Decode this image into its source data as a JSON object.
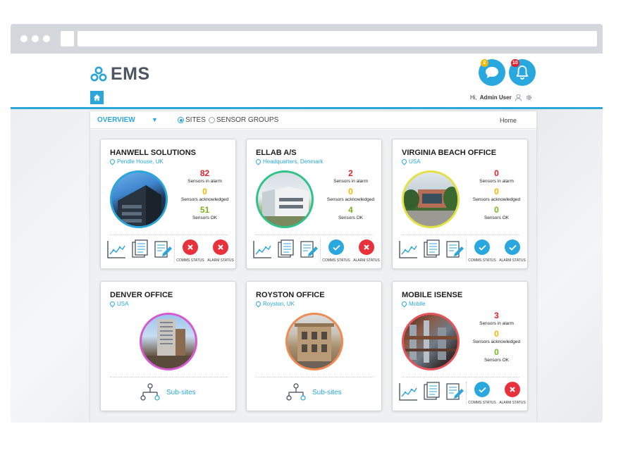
{
  "app": {
    "name": "EMS"
  },
  "header": {
    "chat_badge": "2",
    "alarm_badge": "10",
    "greeting": "Hi,",
    "user_name": "Admin User"
  },
  "tabbar": {
    "overview_label": "OVERVIEW",
    "caret": "▼",
    "sites_label": "SITES",
    "groups_label": "SENSOR GROUPS",
    "breadcrumb": "Home"
  },
  "labels": {
    "in_alarm": "Sensors in alarm",
    "acknowledged": "Sensors acknowledged",
    "ok": "Sensors OK",
    "comms_status": "COMMS STATUS",
    "alarm_status": "ALARM STATUS",
    "subsites": "Sub-sites"
  },
  "colors": {
    "accent": "#2ba6d9",
    "alarm_red": "#e2222b",
    "ack_yellow": "#f2b705",
    "ok_green": "#79b61d",
    "status_ok": "#29a8df",
    "status_bad": "#e8313a"
  },
  "cards": [
    {
      "title": "HANWELL SOLUTIONS",
      "location": "Pendle House, UK",
      "alarm": "82",
      "ack": "0",
      "ok": "51",
      "ring": "#2ba6d9",
      "comms": "bad",
      "alarm_state": "bad"
    },
    {
      "title": "ELLAB A/S",
      "location": "Headquarters, Denmark",
      "alarm": "2",
      "ack": "0",
      "ok": "4",
      "ring": "#2fc38a",
      "comms": "ok",
      "alarm_state": "bad"
    },
    {
      "title": "VIRGINIA BEACH OFFICE",
      "location": "USA",
      "alarm": "0",
      "ack": "0",
      "ok": "0",
      "ring": "#e3e146",
      "comms": "ok",
      "alarm_state": "ok"
    },
    {
      "title": "DENVER OFFICE",
      "location": "USA",
      "ring": "#d45ad0"
    },
    {
      "title": "ROYSTON OFFICE",
      "location": "Royston, UK",
      "ring": "#ef8a52"
    },
    {
      "title": "MOBILE ISENSE",
      "location": "Mobile",
      "alarm": "3",
      "ack": "0",
      "ok": "0",
      "ring": "#e8535a",
      "comms": "ok",
      "alarm_state": "bad"
    }
  ]
}
